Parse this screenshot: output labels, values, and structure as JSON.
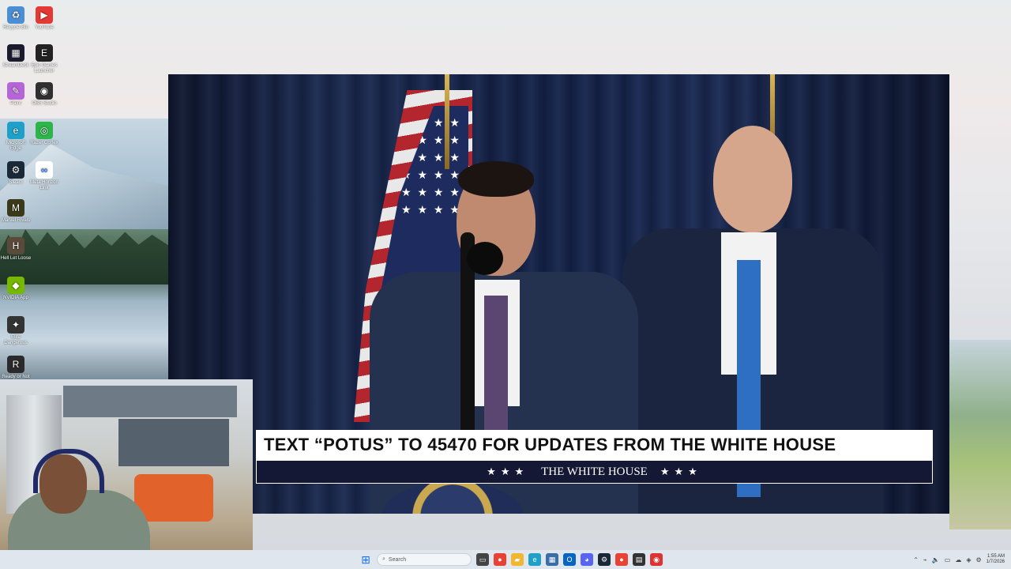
{
  "desktop": {
    "icons": [
      {
        "label": "Recycle Bin",
        "glyph": "♻",
        "color": "#4a8fd6"
      },
      {
        "label": "YouTube",
        "glyph": "▶",
        "color": "#e53935"
      },
      {
        "label": "StreamDeck",
        "glyph": "▦",
        "color": "#1b1b2f"
      },
      {
        "label": "Epic Games Launcher",
        "glyph": "E",
        "color": "#222222"
      },
      {
        "label": "Paint",
        "glyph": "✎",
        "color": "#b565d8"
      },
      {
        "label": "OBS Studio",
        "glyph": "◉",
        "color": "#303030"
      },
      {
        "label": "Microsoft Edge",
        "glyph": "e",
        "color": "#1fa0c9"
      },
      {
        "label": "Razer Cortex",
        "glyph": "◎",
        "color": "#2bb54a"
      },
      {
        "label": "Steam",
        "glyph": "⚙",
        "color": "#1b2838"
      },
      {
        "label": "Meta Horizon Link",
        "glyph": "∞",
        "color": "#ffffff"
      },
      {
        "label": "Marvel Rivals",
        "glyph": "M",
        "color": "#3a3a1a"
      },
      {
        "label": "Hell Let Loose",
        "glyph": "H",
        "color": "#5a4a3a"
      },
      {
        "label": "NVIDIA App",
        "glyph": "◆",
        "color": "#76b900"
      },
      {
        "label": "Elite Dangerous",
        "glyph": "✦",
        "color": "#333333"
      },
      {
        "label": "Ready or Not",
        "glyph": "R",
        "color": "#2a2a2a"
      }
    ]
  },
  "video": {
    "banner_top": "TEXT “POTUS” TO 45470 FOR UPDATES FROM THE WHITE HOUSE",
    "banner_stars_left": "★★★",
    "banner_bottom": "THE WHITE HOUSE",
    "banner_stars_right": "★★★"
  },
  "taskbar": {
    "start_icon": "windows-start-icon",
    "search_placeholder": "Search",
    "apps": [
      {
        "name": "file-explorer",
        "glyph": "▭",
        "color": "#444444"
      },
      {
        "name": "chrome",
        "glyph": "●",
        "color": "#e94235"
      },
      {
        "name": "folder",
        "glyph": "▰",
        "color": "#f2b632"
      },
      {
        "name": "edge",
        "glyph": "e",
        "color": "#1fa0c9"
      },
      {
        "name": "calculator",
        "glyph": "▦",
        "color": "#3a6ea5"
      },
      {
        "name": "outlook",
        "glyph": "O",
        "color": "#0a64c2"
      },
      {
        "name": "discord",
        "glyph": "◕",
        "color": "#5865f2"
      },
      {
        "name": "steam",
        "glyph": "⚙",
        "color": "#1b2838"
      },
      {
        "name": "chrome-2",
        "glyph": "●",
        "color": "#e94235"
      },
      {
        "name": "terminal",
        "glyph": "▤",
        "color": "#333333"
      },
      {
        "name": "obs",
        "glyph": "◉",
        "color": "#d33"
      }
    ],
    "time": "1:55 AM",
    "date": "1/7/2026"
  }
}
